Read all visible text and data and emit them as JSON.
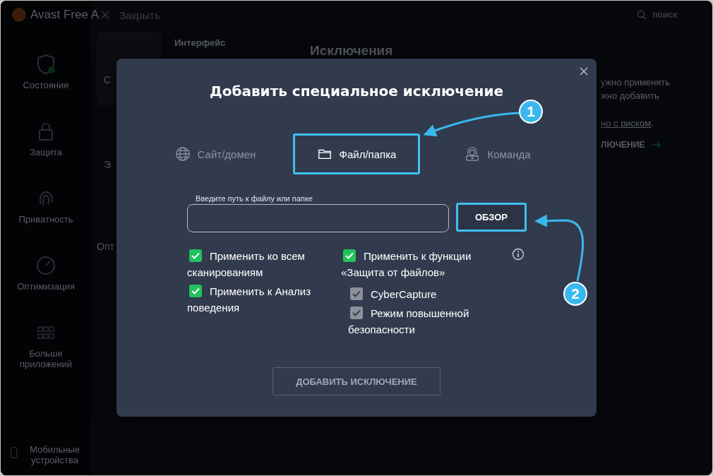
{
  "app": {
    "title": "Avast Free A",
    "close": "Закрыть",
    "search": "поиск"
  },
  "sidebar": {
    "items": [
      {
        "label": "Состояние"
      },
      {
        "label": "Защита"
      },
      {
        "label": "Приватность"
      },
      {
        "label": "Оптимизация"
      },
      {
        "label": "Больше приложений"
      },
      {
        "label": "Мобильные устройства"
      }
    ]
  },
  "background": {
    "nav_heading": "Интерфейс",
    "page_title": "Исключения",
    "fragments": [
      "С",
      "Э",
      "Опт"
    ],
    "right_lines": [
      "ужно применять",
      "жно добавить"
    ],
    "risk_link": "но с риском",
    "risk_tail": ".",
    "add_link": "ЛЮЧЕНИЕ"
  },
  "dialog": {
    "title": "Добавить специальное исключение",
    "tabs": [
      {
        "label": "Сайт/домен",
        "selected": false,
        "highlighted": false
      },
      {
        "label": "Файл/папка",
        "selected": true,
        "highlighted": true
      },
      {
        "label": "Команда",
        "selected": false,
        "highlighted": false
      }
    ],
    "path_field": {
      "label": "Введите путь к файлу или папке"
    },
    "browse_button": {
      "label": "ОБЗОР",
      "highlighted": true
    },
    "options": [
      [
        {
          "label": "Применить ко всем сканированиям",
          "checked": true,
          "disabled": false
        },
        {
          "label": "Применить к Анализ поведения",
          "checked": true,
          "disabled": false
        }
      ],
      [
        {
          "label": "Применить к функции «Защита от файлов»",
          "checked": true,
          "disabled": false,
          "info": true,
          "children": [
            {
              "label": "CyberCapture",
              "checked": true,
              "disabled": true
            },
            {
              "label": "Режим повышенной безопасности",
              "checked": true,
              "disabled": true
            }
          ]
        }
      ]
    ],
    "add_button": {
      "label": "ДОБАВИТЬ ИСКЛЮЧЕНИЕ",
      "disabled": true
    }
  },
  "annotations": [
    {
      "number": "1"
    },
    {
      "number": "2"
    }
  ]
}
